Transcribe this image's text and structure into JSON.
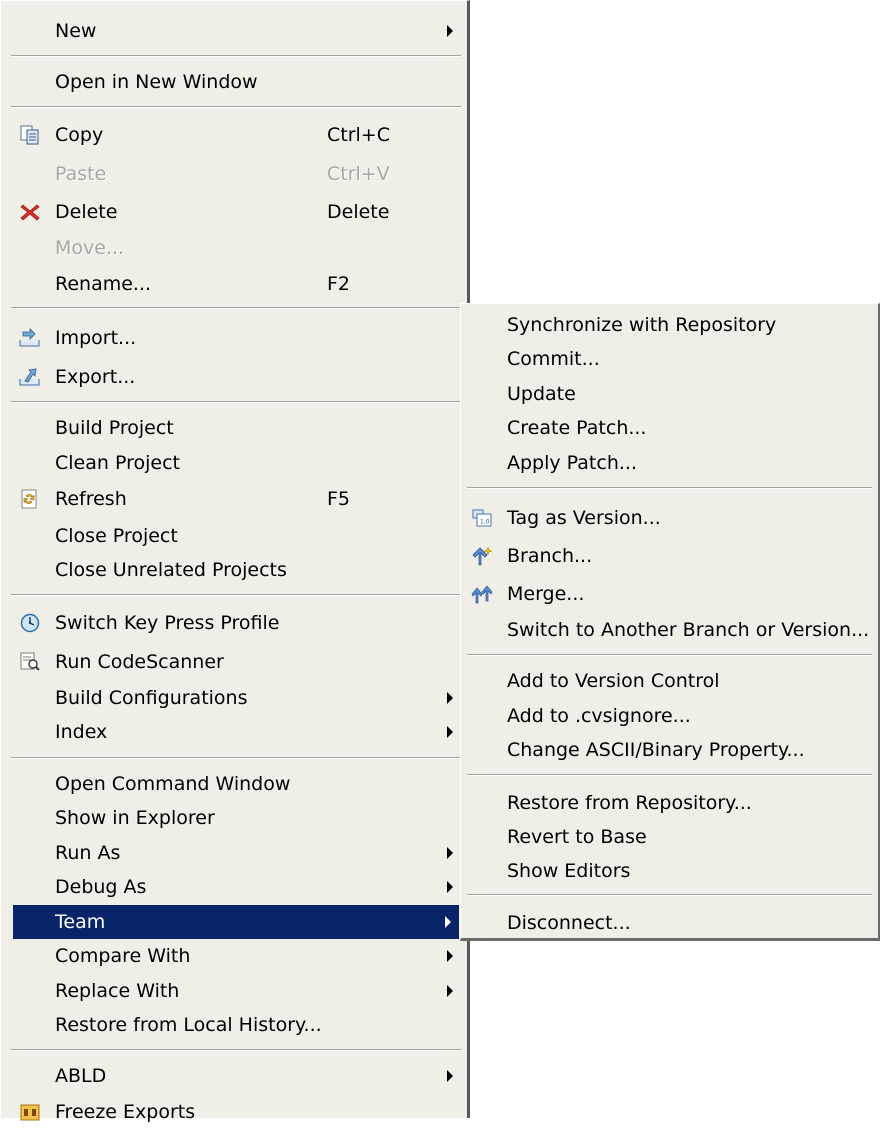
{
  "main_menu": {
    "new": "New",
    "open_new_window": "Open in New Window",
    "copy": "Copy",
    "copy_accel": "Ctrl+C",
    "paste": "Paste",
    "paste_accel": "Ctrl+V",
    "delete": "Delete",
    "delete_accel": "Delete",
    "move": "Move...",
    "rename": "Rename...",
    "rename_accel": "F2",
    "import": "Import...",
    "export": "Export...",
    "build_project": "Build Project",
    "clean_project": "Clean Project",
    "refresh": "Refresh",
    "refresh_accel": "F5",
    "close_project": "Close Project",
    "close_unrelated": "Close Unrelated Projects",
    "switch_key_profile": "Switch Key Press Profile",
    "run_codescanner": "Run CodeScanner",
    "build_configurations": "Build Configurations",
    "index": "Index",
    "open_command_window": "Open Command Window",
    "show_in_explorer": "Show in Explorer",
    "run_as": "Run As",
    "debug_as": "Debug As",
    "team": "Team",
    "compare_with": "Compare With",
    "replace_with": "Replace With",
    "restore_local_history": "Restore from Local History...",
    "abld": "ABLD",
    "freeze_exports": "Freeze Exports"
  },
  "team_menu": {
    "synchronize": "Synchronize with Repository",
    "commit": "Commit...",
    "update": "Update",
    "create_patch": "Create Patch...",
    "apply_patch": "Apply Patch...",
    "tag_as_version": "Tag as Version...",
    "branch": "Branch...",
    "merge": "Merge...",
    "switch_branch": "Switch to Another Branch or Version...",
    "add_version_control": "Add to Version Control",
    "add_cvsignore": "Add to .cvsignore...",
    "change_ascii_binary": "Change ASCII/Binary Property...",
    "restore_repository": "Restore from Repository...",
    "revert_to_base": "Revert to Base",
    "show_editors": "Show Editors",
    "disconnect": "Disconnect..."
  },
  "colors": {
    "menu_bg": "#f0efe7",
    "selection_bg": "#0a246a",
    "disabled_text": "#a8a7a0"
  },
  "icons": {
    "copy": "copy-icon",
    "delete": "delete-icon",
    "import": "import-icon",
    "export": "export-icon",
    "refresh": "refresh-icon",
    "switch_key_profile": "clock-icon",
    "run_codescanner": "codescanner-icon",
    "freeze_exports": "freeze-icon",
    "tag_as_version": "tag-icon",
    "branch": "branch-icon",
    "merge": "merge-icon"
  }
}
